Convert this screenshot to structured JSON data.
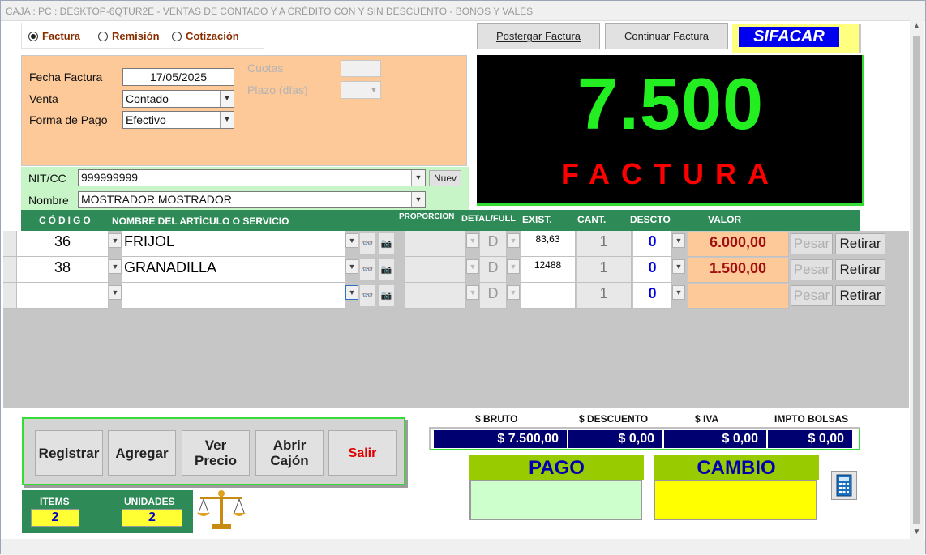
{
  "window": {
    "title": "CAJA :  PC : DESKTOP-6QTUR2E  - VENTAS DE CONTADO Y A CRÉDITO CON Y SIN DESCUENTO - BONOS Y VALES"
  },
  "doc_type": {
    "options": [
      "Factura",
      "Remisión",
      "Cotización"
    ],
    "selected": "Factura"
  },
  "invoice": {
    "fecha_label": "Fecha Factura",
    "fecha_value": "17/05/2025",
    "venta_label": "Venta",
    "venta_value": "Contado",
    "forma_pago_label": "Forma de Pago",
    "forma_pago_value": "Efectivo",
    "cuotas_label": "Cuotas",
    "plazo_label": "Plazo (días)"
  },
  "customer": {
    "nit_label": "NIT/CC",
    "nit_value": "999999999",
    "nuevo_button": "Nuev",
    "nombre_label": "Nombre",
    "nombre_value": "MOSTRADOR MOSTRADOR"
  },
  "top_buttons": {
    "postergar": "Postergar  Factura",
    "continuar": "Continuar Factura",
    "brand": "SIFACAR"
  },
  "display": {
    "amount": "7.500",
    "label": "FACTURA"
  },
  "table": {
    "headers": {
      "codigo": "CÓDIGO",
      "nombre": "NOMBRE DEL ARTÍCULO O SERVICIO",
      "proporcion": "PROPORCION",
      "detal_full": "DETAL/FULL",
      "exist": "EXIST.",
      "cant": "CANT.",
      "descto": "DESCTO",
      "valor": "VALOR"
    },
    "rows": [
      {
        "codigo": "36",
        "nombre": "FRIJOL",
        "detal": "D",
        "exist": "83,63",
        "cant": "1",
        "descto": "0",
        "valor": "6.000,00",
        "pesar": "Pesar",
        "retirar": "Retirar"
      },
      {
        "codigo": "38",
        "nombre": "GRANADILLA",
        "detal": "D",
        "exist": "12488",
        "cant": "1",
        "descto": "0",
        "valor": "1.500,00",
        "pesar": "Pesar",
        "retirar": "Retirar"
      },
      {
        "codigo": "",
        "nombre": "",
        "detal": "D",
        "exist": "",
        "cant": "1",
        "descto": "0",
        "valor": "",
        "pesar": "Pesar",
        "retirar": "Retirar"
      }
    ]
  },
  "actions": {
    "registrar": "Registrar",
    "agregar": "Agregar",
    "ver_precio_1": "Ver",
    "ver_precio_2": "Precio",
    "abrir_cajon_1": "Abrir",
    "abrir_cajon_2": "Cajón",
    "salir": "Salir"
  },
  "counts": {
    "items_label": "ITEMS",
    "items_value": "2",
    "unidades_label": "UNIDADES",
    "unidades_value": "2"
  },
  "totals": {
    "bruto_label": "$ BRUTO",
    "bruto_value": "$ 7.500,00",
    "descuento_label": "$ DESCUENTO",
    "descuento_value": "$ 0,00",
    "iva_label": "$ IVA",
    "iva_value": "$ 0,00",
    "bolsas_label": "IMPTO  BOLSAS",
    "bolsas_value": "$ 0,00"
  },
  "payment": {
    "pago_label": "PAGO",
    "cambio_label": "CAMBIO"
  },
  "colors": {
    "peach": "#fdc999",
    "header_green": "#2e8b57",
    "display_green": "#22ee22",
    "display_red": "#ff0000",
    "navy": "#000070",
    "pago_box": "#ccffcc",
    "cambio_box": "#ffff00"
  },
  "icons": [
    "scale-icon",
    "calculator-icon",
    "glasses-icon",
    "camera-icon"
  ]
}
